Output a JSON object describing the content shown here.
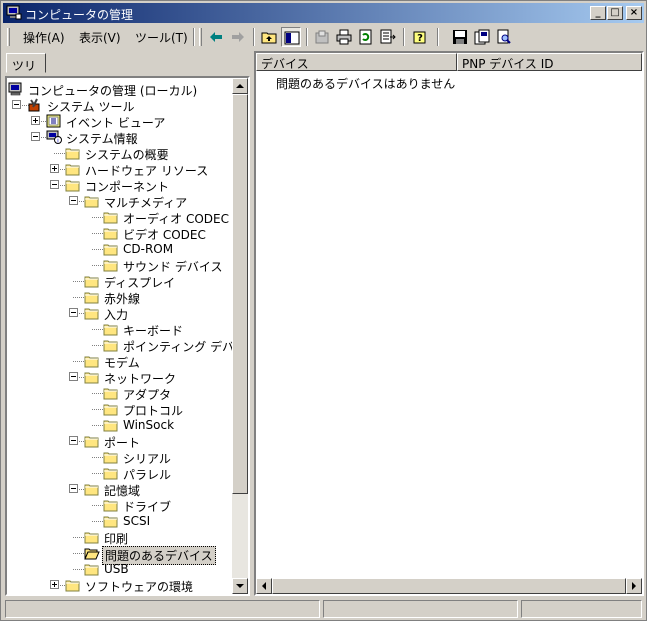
{
  "window": {
    "title": "コンピュータの管理",
    "minimize_label": "_",
    "maximize_label": "□",
    "close_label": "×"
  },
  "menu": {
    "action": "操作(A)",
    "view": "表示(V)",
    "tools": "ツール(T)"
  },
  "toolbar": {
    "icons": [
      "back-icon",
      "forward-icon",
      "up-folder-icon",
      "show-hide-tree-icon",
      "properties-icon",
      "print-icon",
      "refresh-icon",
      "export-list-icon",
      "help-icon",
      "save-icon",
      "find-icon",
      "search-icon"
    ]
  },
  "tree_pane": {
    "tab": "ツリー",
    "items": [
      {
        "label": "コンピュータの管理 (ローカル)",
        "icon": "computer-icon"
      },
      {
        "label": "システム ツール",
        "icon": "tools-icon"
      },
      {
        "label": "イベント ビューア",
        "icon": "event-viewer-icon"
      },
      {
        "label": "システム情報",
        "icon": "system-info-icon"
      },
      {
        "label": "システムの概要",
        "icon": "folder-icon"
      },
      {
        "label": "ハードウェア リソース",
        "icon": "folder-icon"
      },
      {
        "label": "コンポーネント",
        "icon": "folder-icon"
      },
      {
        "label": "マルチメディア",
        "icon": "folder-icon"
      },
      {
        "label": "オーディオ CODEC",
        "icon": "folder-icon"
      },
      {
        "label": "ビデオ CODEC",
        "icon": "folder-icon"
      },
      {
        "label": "CD-ROM",
        "icon": "folder-icon"
      },
      {
        "label": "サウンド デバイス",
        "icon": "folder-icon"
      },
      {
        "label": "ディスプレイ",
        "icon": "folder-icon"
      },
      {
        "label": "赤外線",
        "icon": "folder-icon"
      },
      {
        "label": "入力",
        "icon": "folder-icon"
      },
      {
        "label": "キーボード",
        "icon": "folder-icon"
      },
      {
        "label": "ポインティング デバイス",
        "icon": "folder-icon"
      },
      {
        "label": "モデム",
        "icon": "folder-icon"
      },
      {
        "label": "ネットワーク",
        "icon": "folder-icon"
      },
      {
        "label": "アダプタ",
        "icon": "folder-icon"
      },
      {
        "label": "プロトコル",
        "icon": "folder-icon"
      },
      {
        "label": "WinSock",
        "icon": "folder-icon"
      },
      {
        "label": "ポート",
        "icon": "folder-icon"
      },
      {
        "label": "シリアル",
        "icon": "folder-icon"
      },
      {
        "label": "パラレル",
        "icon": "folder-icon"
      },
      {
        "label": "記憶域",
        "icon": "folder-icon"
      },
      {
        "label": "ドライブ",
        "icon": "folder-icon"
      },
      {
        "label": "SCSI",
        "icon": "folder-icon"
      },
      {
        "label": "印刷",
        "icon": "folder-icon"
      },
      {
        "label": "問題のあるデバイス",
        "icon": "folder-open-icon",
        "selected": true
      },
      {
        "label": "USB",
        "icon": "folder-icon"
      },
      {
        "label": "ソフトウェアの環境",
        "icon": "folder-icon"
      }
    ]
  },
  "list_pane": {
    "columns": [
      "デバイス",
      "PNP デバイス ID"
    ],
    "empty_message": "問題のあるデバイスはありません"
  },
  "colors": {
    "title_start": "#0a246a",
    "title_end": "#a6caf0",
    "chrome": "#d4d0c8",
    "folder": "#ffe680"
  }
}
